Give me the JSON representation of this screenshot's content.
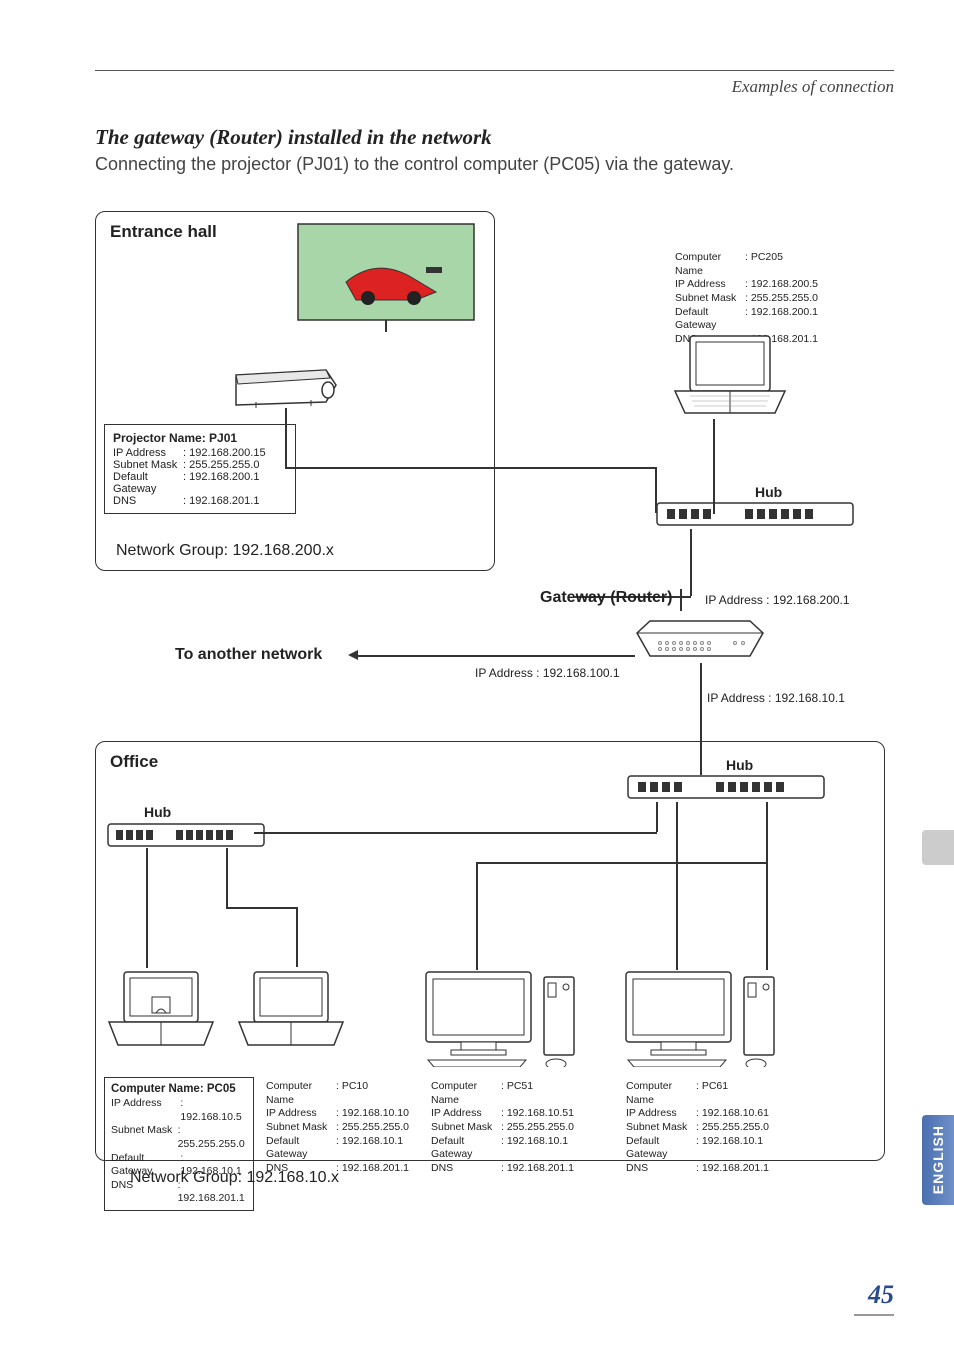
{
  "header": {
    "breadcrumb": "Examples of connection"
  },
  "title": "The gateway (Router) installed in the network",
  "intro": "Connecting the projector (PJ01) to the control computer (PC05) via the gateway.",
  "top_panel": {
    "title": "Entrance hall",
    "projector": {
      "title": "Projector Name: PJ01",
      "rows": [
        {
          "k": "IP Address",
          "v": ": 192.168.200.15"
        },
        {
          "k": "Subnet Mask",
          "v": ": 255.255.255.0"
        },
        {
          "k": "Default Gateway",
          "v": ": 192.168.200.1"
        },
        {
          "k": "DNS",
          "v": ": 192.168.201.1"
        }
      ]
    },
    "network_group": "Network Group: 192.168.200.x",
    "hub_label": "Hub",
    "pc205": {
      "rows": [
        {
          "k": "Computer Name",
          "v": ": PC205"
        },
        {
          "k": "IP Address",
          "v": ": 192.168.200.5"
        },
        {
          "k": "Subnet Mask",
          "v": ": 255.255.255.0"
        },
        {
          "k": "Default Gateway",
          "v": ": 192.168.200.1"
        },
        {
          "k": "DNS",
          "v": ": 192.168.201.1"
        }
      ]
    }
  },
  "gateway": {
    "label": "Gateway (Router)",
    "ip_top": "IP Address : 192.168.200.1",
    "to_another": "To another network",
    "ip_left": "IP Address : 192.168.100.1",
    "ip_bottom": "IP Address : 192.168.10.1"
  },
  "bottom_panel": {
    "title": "Office",
    "hub_label_left": "Hub",
    "hub_label_right": "Hub",
    "network_group": "Network Group: 192.168.10.x",
    "pcs": [
      {
        "title": "Computer Name: PC05",
        "title_bold": true,
        "rows": [
          {
            "k": "IP Address",
            "v": ": 192.168.10.5"
          },
          {
            "k": "Subnet Mask",
            "v": ": 255.255.255.0"
          },
          {
            "k": "Default Gateway",
            "v": ": 192.168.10.1"
          },
          {
            "k": "DNS",
            "v": ": 192.168.201.1"
          }
        ]
      },
      {
        "title": "Computer Name",
        "tval": ": PC10",
        "rows": [
          {
            "k": "IP Address",
            "v": ": 192.168.10.10"
          },
          {
            "k": "Subnet Mask",
            "v": ": 255.255.255.0"
          },
          {
            "k": "Default Gateway",
            "v": ": 192.168.10.1"
          },
          {
            "k": "DNS",
            "v": ": 192.168.201.1"
          }
        ]
      },
      {
        "title": "Computer Name",
        "tval": ": PC51",
        "rows": [
          {
            "k": "IP Address",
            "v": ": 192.168.10.51"
          },
          {
            "k": "Subnet Mask",
            "v": ": 255.255.255.0"
          },
          {
            "k": "Default Gateway",
            "v": ": 192.168.10.1"
          },
          {
            "k": "DNS",
            "v": ": 192.168.201.1"
          }
        ]
      },
      {
        "title": "Computer Name",
        "tval": ": PC61",
        "rows": [
          {
            "k": "IP Address",
            "v": ": 192.168.10.61"
          },
          {
            "k": "Subnet Mask",
            "v": ": 255.255.255.0"
          },
          {
            "k": "Default Gateway",
            "v": ": 192.168.10.1"
          },
          {
            "k": "DNS",
            "v": ": 192.168.201.1"
          }
        ]
      }
    ]
  },
  "sidebar": {
    "lang": "ENGLISH"
  },
  "page_number": "45"
}
